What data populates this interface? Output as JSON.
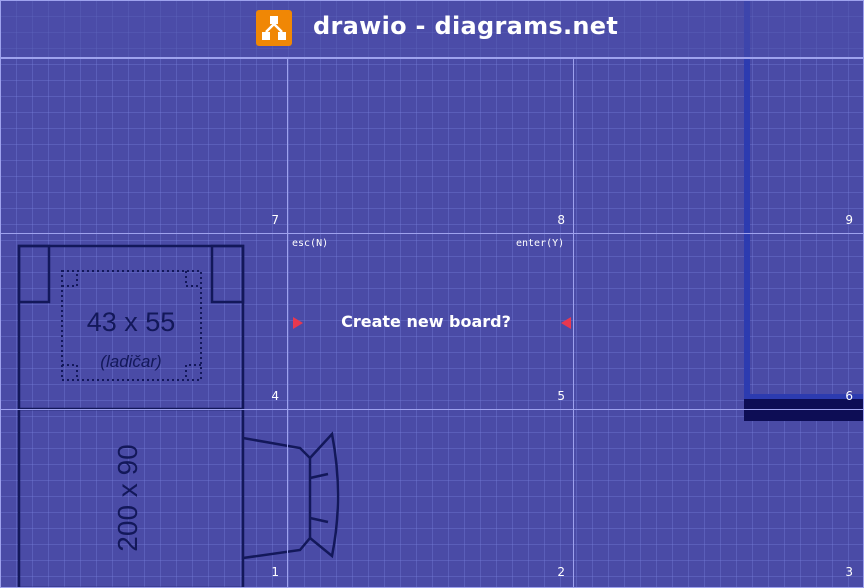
{
  "window": {
    "title": "drawio - diagrams.net",
    "logo_icon": "drawio-logo-icon",
    "accent_color": "#f08705"
  },
  "board": {
    "cells": [
      {
        "key": "7",
        "label": "7"
      },
      {
        "key": "8",
        "label": "8"
      },
      {
        "key": "9",
        "label": "9"
      },
      {
        "key": "4",
        "label": "4"
      },
      {
        "key": "5",
        "label": "5"
      },
      {
        "key": "6",
        "label": "6"
      },
      {
        "key": "1",
        "label": "1"
      },
      {
        "key": "2",
        "label": "2"
      },
      {
        "key": "3",
        "label": "3"
      }
    ]
  },
  "dialog": {
    "prompt": "Create new board?",
    "cancel_hint": "esc(N)",
    "confirm_hint": "enter(Y)"
  },
  "diagram": {
    "desk_label": "43 x 55",
    "desk_sublabel": "(ladičar)",
    "bed_label": "200 x 90"
  }
}
